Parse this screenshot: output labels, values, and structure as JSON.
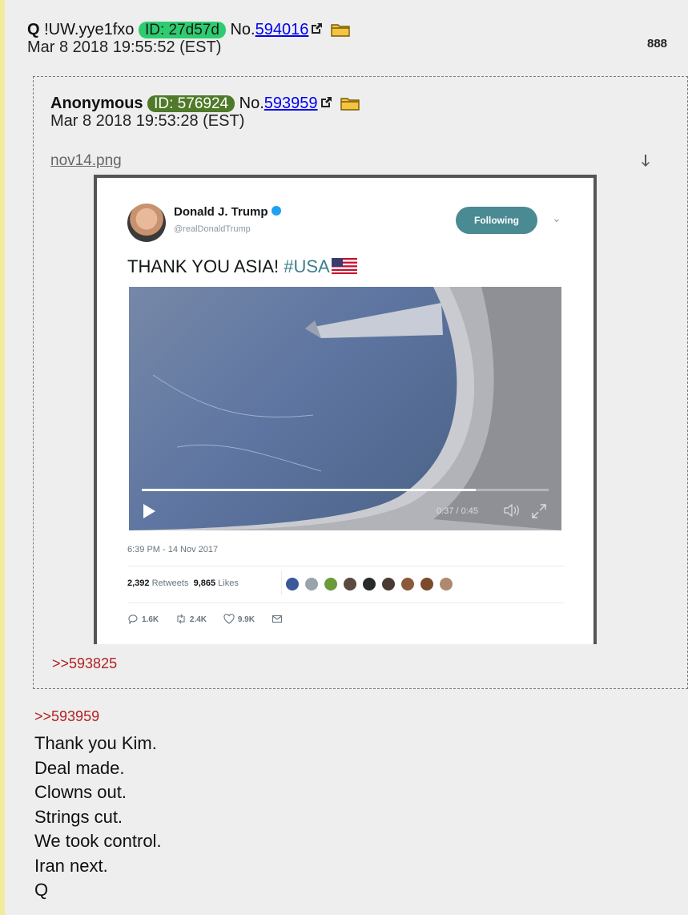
{
  "post": {
    "name": "Q",
    "tripcode": "!UW.yye1fxo",
    "id_label": "ID: 27d57d",
    "id_color": "#2ecc71",
    "no_prefix": "No.",
    "post_number": "594016",
    "date": "Mar 8 2018 19:55:52 (EST)",
    "post_count": "888",
    "reply_to": ">>593959",
    "body_lines": [
      "Thank you Kim.",
      "Deal made.",
      "Clowns out.",
      "Strings cut.",
      "We took control.",
      "Iran next.",
      "Q"
    ]
  },
  "quoted_post": {
    "name": "Anonymous",
    "id_label": "ID: 576924",
    "id_color": "#4f7a2a",
    "no_prefix": "No.",
    "post_number": "593959",
    "date": "Mar 8 2018 19:53:28 (EST)",
    "filename": "nov14.png",
    "backlink": ">>593825"
  },
  "tweet": {
    "display_name": "Donald J. Trump",
    "handle": "@realDonaldTrump",
    "follow_label": "Following",
    "text_plain": "THANK YOU ASIA! ",
    "text_hashtag": "#USA",
    "video_time": "0:37 / 0:45",
    "video_progress": 0.82,
    "timestamp": "6:39 PM - 14 Nov 2017",
    "retweets_count": "2,392",
    "retweets_label": "Retweets",
    "likes_count": "9,865",
    "likes_label": "Likes",
    "reply_count": "1.6K",
    "retweet_action_count": "2.4K",
    "like_action_count": "9.9K"
  },
  "colors": {
    "post_bg": "#eeeeee",
    "link": "#0000ee",
    "quote_link": "#b22222",
    "left_bar": "#f2eb9e"
  }
}
